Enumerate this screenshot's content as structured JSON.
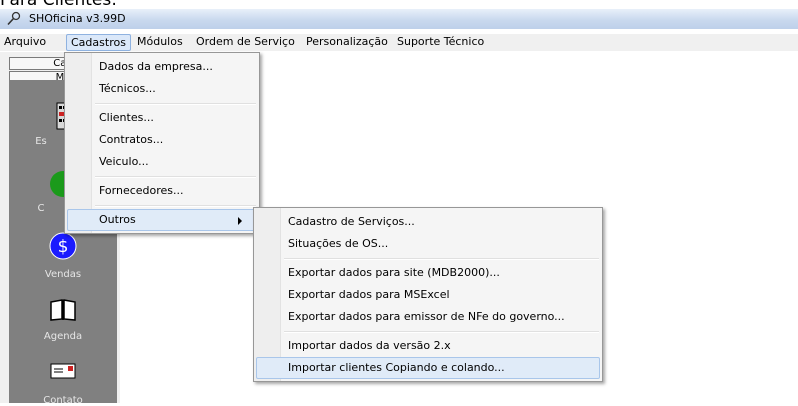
{
  "caption": "Para Clientes:",
  "window": {
    "title": "SHOficina v3.99D"
  },
  "menubar": {
    "items": [
      {
        "label": "Arquivo"
      },
      {
        "label": "Cadastros"
      },
      {
        "label": "Módulos"
      },
      {
        "label": "Ordem de Serviço"
      },
      {
        "label": "Personalização"
      },
      {
        "label": "Suporte Técnico"
      }
    ]
  },
  "sidebar": {
    "tab1": "Cad",
    "tab2": "Mó",
    "buttons": [
      {
        "label": "Es",
        "icon": "building-icon"
      },
      {
        "label": "C",
        "icon": "green-circle-icon"
      },
      {
        "label": "Vendas",
        "icon": "dollar-icon"
      },
      {
        "label": "Agenda",
        "icon": "book-icon"
      },
      {
        "label": "Contato",
        "icon": "envelope-icon"
      }
    ]
  },
  "cadastros_menu": {
    "items": [
      {
        "label": "Dados da empresa..."
      },
      {
        "label": "Técnicos..."
      },
      {
        "label": "Clientes..."
      },
      {
        "label": "Contratos..."
      },
      {
        "label": "Veiculo..."
      },
      {
        "label": "Fornecedores..."
      },
      {
        "label": "Outros"
      }
    ]
  },
  "outros_menu": {
    "items": [
      {
        "label": "Cadastro de Serviços..."
      },
      {
        "label": "Situações de OS..."
      },
      {
        "label": "Exportar dados para site (MDB2000)..."
      },
      {
        "label": "Exportar dados para MSExcel"
      },
      {
        "label": "Exportar dados para emissor de NFe do governo..."
      },
      {
        "label": "Importar dados da versão 2.x"
      },
      {
        "label": "Importar clientes Copiando e colando..."
      }
    ]
  },
  "colors": {
    "highlight": "#e0ebf8",
    "panel_gray": "#808080",
    "vendas_blue": "#1a1aff"
  }
}
